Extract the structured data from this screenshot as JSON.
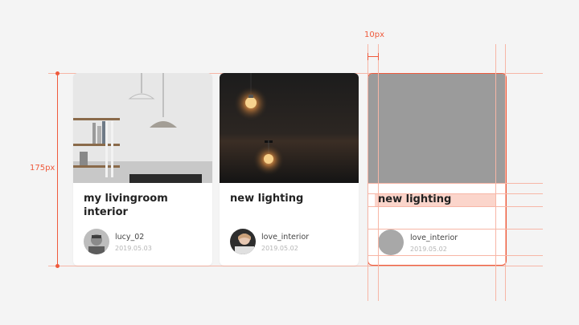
{
  "annotations": {
    "height_label": "175px",
    "gap_label": "10px"
  },
  "cards": [
    {
      "title": "my livingroom interior",
      "user": "lucy_02",
      "date": "2019.05.03",
      "image": "livingroom-photo",
      "avatar": "user-avatar"
    },
    {
      "title": "new lighting",
      "user": "love_interior",
      "date": "2019.05.02",
      "image": "lightbulb-photo",
      "avatar": "user-avatar"
    },
    {
      "title": "new lighting",
      "user": "love_interior",
      "date": "2019.05.02",
      "image": "placeholder-gray",
      "avatar": "placeholder-avatar"
    }
  ],
  "colors": {
    "accent": "#ef5a3c",
    "guide": "#f7b6a6",
    "placeholder": "#9b9b9b"
  }
}
